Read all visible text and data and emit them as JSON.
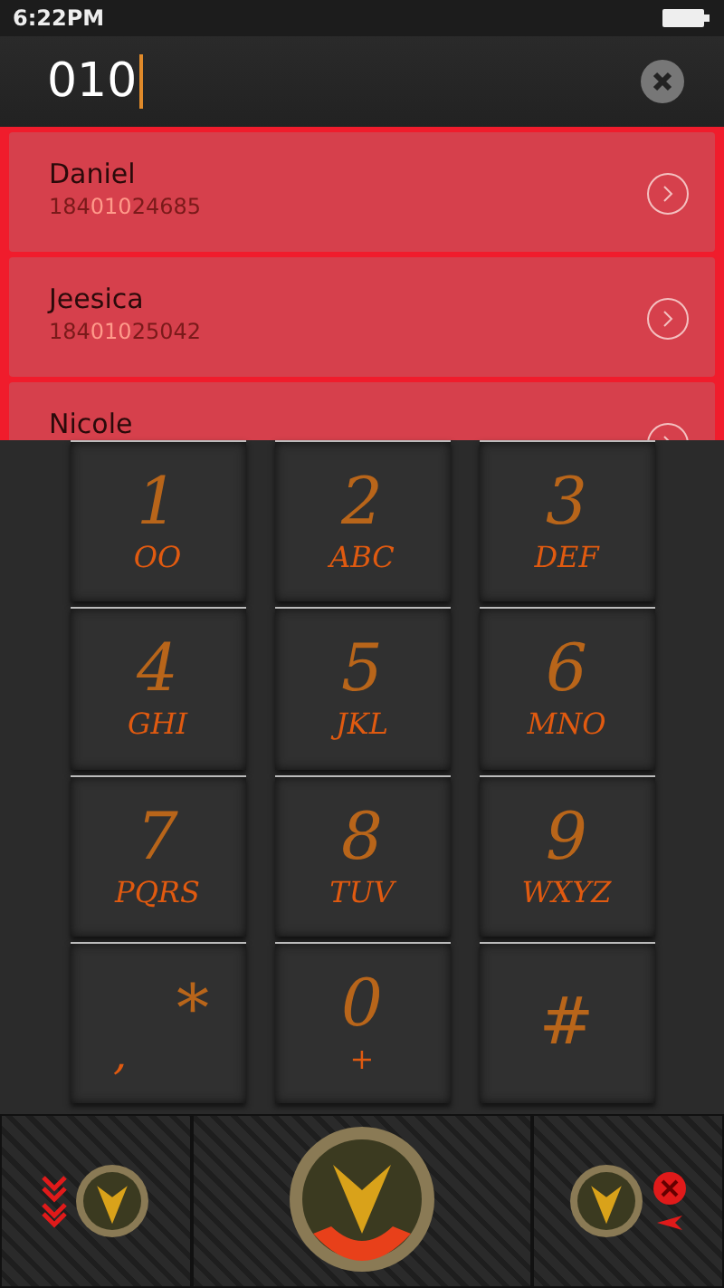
{
  "status_bar": {
    "time": "6:22PM"
  },
  "dial_field": {
    "value": "010"
  },
  "contacts": [
    {
      "name": "Daniel",
      "number_before": "184",
      "number_match": "010",
      "number_after": "24685"
    },
    {
      "name": "Jeesica",
      "number_before": "184",
      "number_match": "010",
      "number_after": "25042"
    },
    {
      "name": "Nicole"
    }
  ],
  "keypad": [
    {
      "kind": "digit",
      "main": "1",
      "sub": "OO"
    },
    {
      "kind": "digit",
      "main": "2",
      "sub": "ABC"
    },
    {
      "kind": "digit",
      "main": "3",
      "sub": "DEF"
    },
    {
      "kind": "digit",
      "main": "4",
      "sub": "GHI"
    },
    {
      "kind": "digit",
      "main": "5",
      "sub": "JKL"
    },
    {
      "kind": "digit",
      "main": "6",
      "sub": "MNO"
    },
    {
      "kind": "digit",
      "main": "7",
      "sub": "PQRS"
    },
    {
      "kind": "digit",
      "main": "8",
      "sub": "TUV"
    },
    {
      "kind": "digit",
      "main": "9",
      "sub": "WXYZ"
    },
    {
      "kind": "star",
      "main": "*",
      "sub": ","
    },
    {
      "kind": "digit",
      "main": "0",
      "sub": "+"
    },
    {
      "kind": "digit",
      "main": "#"
    }
  ]
}
